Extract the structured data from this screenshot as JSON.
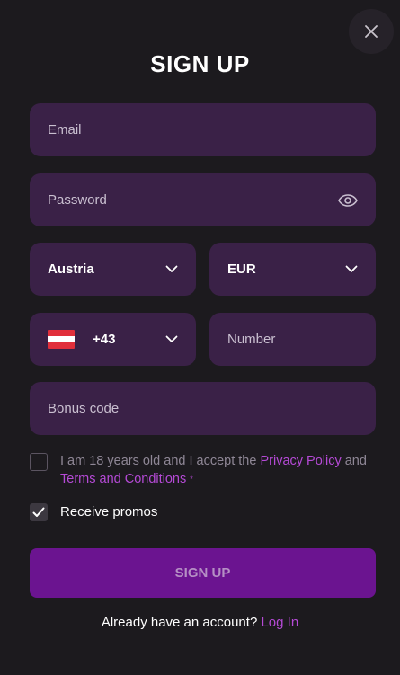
{
  "modal": {
    "title": "SIGN UP",
    "close_icon": "close-icon"
  },
  "form": {
    "email": {
      "placeholder": "Email",
      "value": ""
    },
    "password": {
      "placeholder": "Password",
      "value": "",
      "icon": "eye-icon"
    },
    "country": {
      "value": "Austria",
      "icon": "chevron-down-icon"
    },
    "currency": {
      "value": "EUR",
      "icon": "chevron-down-icon"
    },
    "phone_code": {
      "flag": "austria-flag-icon",
      "value": "+43",
      "icon": "chevron-down-icon"
    },
    "phone_number": {
      "placeholder": "Number",
      "value": ""
    },
    "bonus_code": {
      "placeholder": "Bonus code",
      "value": ""
    }
  },
  "terms": {
    "checked": false,
    "text_before": "I am 18 years old and I accept the ",
    "privacy_link": "Privacy Policy",
    "text_and": " and",
    "terms_link": "Terms and Conditions",
    "required_mark": "*"
  },
  "promos": {
    "checked": true,
    "label": "Receive promos"
  },
  "submit": {
    "label": "SIGN UP"
  },
  "footer": {
    "text": "Already have an account?",
    "link": "Log In"
  },
  "colors": {
    "background": "#1c1a1e",
    "field": "#3a2147",
    "accent": "#b54ad6",
    "button": "#6b1490"
  }
}
